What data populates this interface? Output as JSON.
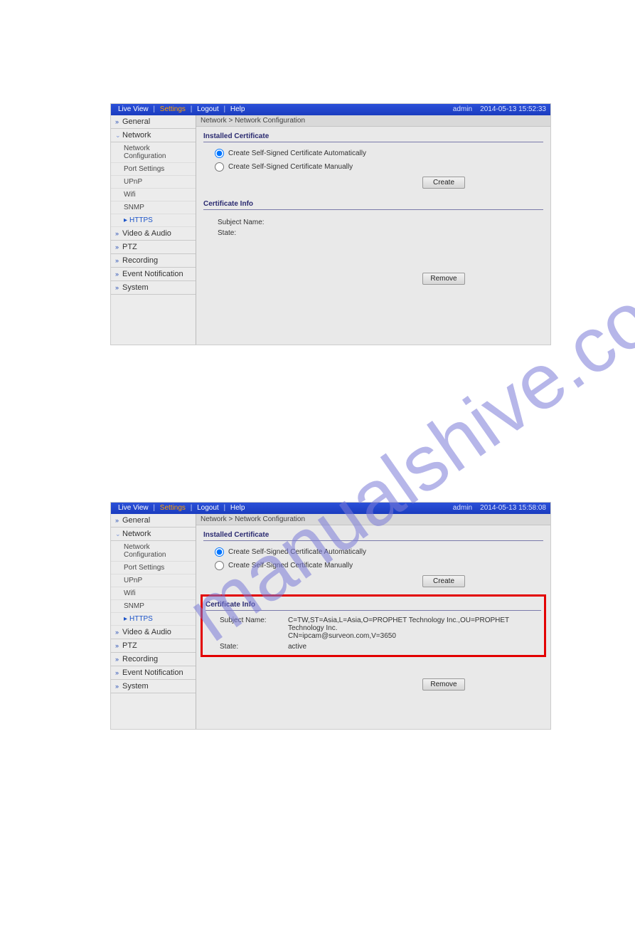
{
  "watermark": "manualshive.com",
  "topbar": {
    "liveview": "Live View",
    "settings": "Settings",
    "logout": "Logout",
    "help": "Help",
    "user": "admin",
    "sep": "|"
  },
  "sidebar": {
    "general": "General",
    "network": "Network",
    "net_items": {
      "netconf": "Network Configuration",
      "port": "Port Settings",
      "upnp": "UPnP",
      "wifi": "Wifi",
      "snmp": "SNMP",
      "https": "HTTPS"
    },
    "videoaudio": "Video & Audio",
    "ptz": "PTZ",
    "recording": "Recording",
    "eventnotif": "Event Notification",
    "system": "System"
  },
  "breadcrumb": "Network > Network Configuration",
  "section": {
    "installed": "Installed Certificate",
    "radio_auto": "Create Self-Signed Certificate Automatically",
    "radio_manual": "Create Self-Signed Certificate Manually",
    "create_btn": "Create",
    "certinfo": "Certificate Info",
    "subject_label": "Subject Name:",
    "state_label": "State:",
    "remove_btn": "Remove"
  },
  "panel1": {
    "datetime": "2014-05-13  15:52:33",
    "subject_value": "",
    "state_value": ""
  },
  "panel2": {
    "datetime": "2014-05-13  15:58:08",
    "subject_line1": "C=TW,ST=Asia,L=Asia,O=PROPHET Technology Inc.,OU=PROPHET Technology Inc.",
    "subject_line2": "CN=ipcam@surveon.com,V=3650",
    "state_value": "active"
  }
}
